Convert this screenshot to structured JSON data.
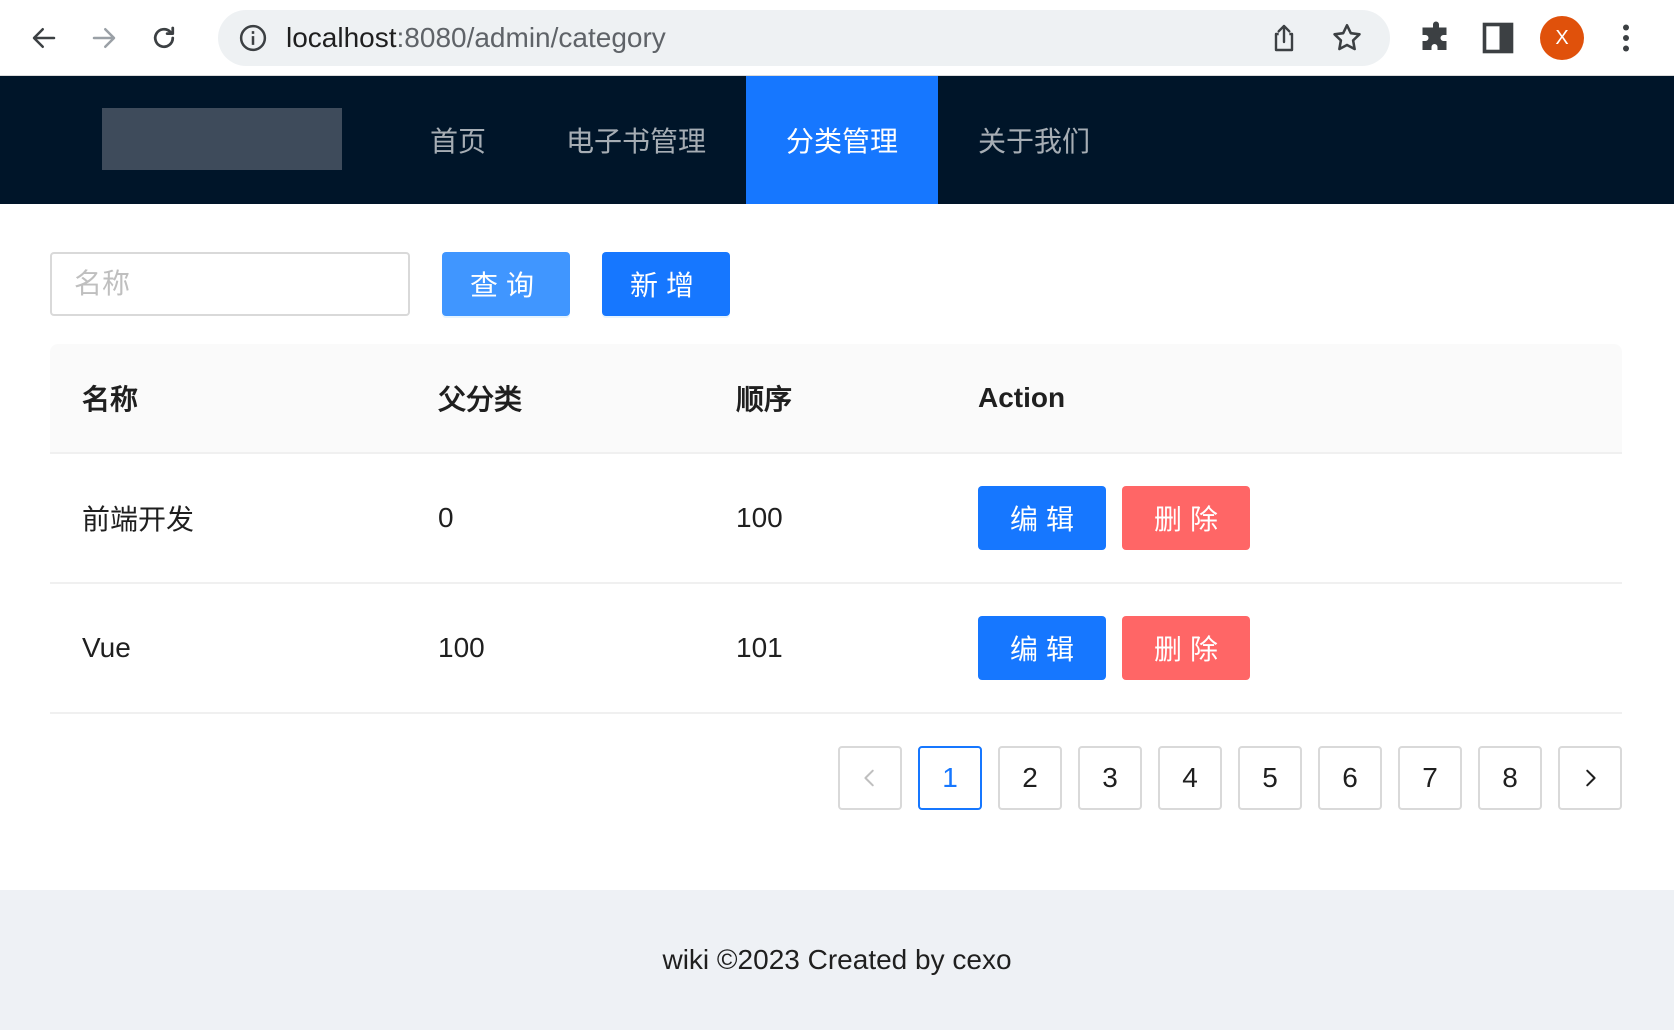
{
  "browser": {
    "url_host": "localhost",
    "url_path": ":8080/admin/category",
    "profile_initial": "X"
  },
  "header": {
    "menu": [
      {
        "label": "首页",
        "active": false
      },
      {
        "label": "电子书管理",
        "active": false
      },
      {
        "label": "分类管理",
        "active": true
      },
      {
        "label": "关于我们",
        "active": false
      }
    ]
  },
  "toolbar": {
    "search_placeholder": "名称",
    "search_value": "",
    "query_label": "查询",
    "add_label": "新增"
  },
  "table": {
    "columns": [
      "名称",
      "父分类",
      "顺序",
      "Action"
    ],
    "rows": [
      {
        "name": "前端开发",
        "parent": "0",
        "sort": "100"
      },
      {
        "name": "Vue",
        "parent": "100",
        "sort": "101"
      }
    ],
    "edit_label": "编辑",
    "delete_label": "删除"
  },
  "pagination": {
    "pages": [
      "1",
      "2",
      "3",
      "4",
      "5",
      "6",
      "7",
      "8"
    ],
    "current": "1"
  },
  "footer": {
    "text": "wiki ©2023 Created by cexo"
  },
  "colors": {
    "header_bg": "#001529",
    "primary": "#1677ff",
    "danger": "#ff6666",
    "footer_bg": "#eef1f5"
  }
}
